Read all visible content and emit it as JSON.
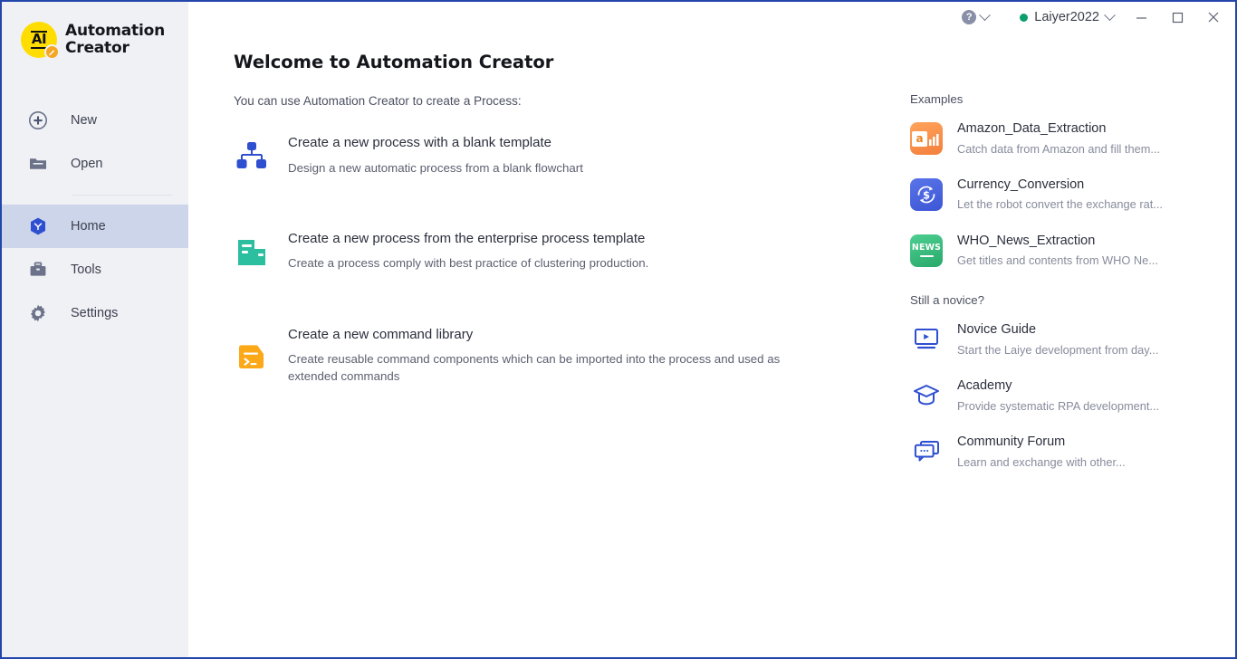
{
  "titlebar": {
    "help_icon": "help-circle-icon",
    "help_caret": "chevron-down-icon",
    "user_name": "Laiyer2022",
    "user_caret": "chevron-down-icon",
    "status_dot_color": "#0b9e6e",
    "minimize_label": "minimize",
    "maximize_label": "maximize",
    "close_label": "close"
  },
  "sidebar": {
    "brand_line1": "Automation",
    "brand_line2": "Creator",
    "brand_badge_icon": "pencil-icon",
    "brand_logo_text": "AI",
    "items": [
      {
        "label": "New",
        "icon": "plus-circle-icon",
        "active": false
      },
      {
        "label": "Open",
        "icon": "folder-icon",
        "active": false
      },
      {
        "label": "Home",
        "icon": "home-cube-icon",
        "active": true
      },
      {
        "label": "Tools",
        "icon": "toolbox-icon",
        "active": false
      },
      {
        "label": "Settings",
        "icon": "gear-icon",
        "active": false
      }
    ]
  },
  "main": {
    "title": "Welcome to Automation Creator",
    "subtitle": "You can use Automation Creator to create a Process:",
    "actions": [
      {
        "icon": "flowchart-icon",
        "title": "Create a new process with a blank template",
        "desc": "Design a new automatic process from a blank flowchart"
      },
      {
        "icon": "enterprise-template-icon",
        "title": "Create a new process from the enterprise process template",
        "desc": "Create a process comply with best practice of clustering production."
      },
      {
        "icon": "command-library-icon",
        "title": "Create a new command library",
        "desc": "Create reusable command components which can be imported into the process and used as extended commands"
      }
    ]
  },
  "right_panel": {
    "examples_title": "Examples",
    "examples": [
      {
        "icon": "amazon-icon",
        "name": "Amazon_Data_Extraction",
        "desc": "Catch data from Amazon and fill them..."
      },
      {
        "icon": "currency-icon",
        "name": "Currency_Conversion",
        "desc": "Let the robot convert the exchange rat..."
      },
      {
        "icon": "news-icon",
        "name": "WHO_News_Extraction",
        "desc": "Get titles and contents from WHO Ne..."
      }
    ],
    "novice_title": "Still a novice?",
    "novice": [
      {
        "icon": "video-player-icon",
        "name": "Novice Guide",
        "desc": "Start the Laiye development from day..."
      },
      {
        "icon": "graduation-cap-icon",
        "name": "Academy",
        "desc": "Provide systematic RPA development..."
      },
      {
        "icon": "chat-bubbles-icon",
        "name": "Community Forum",
        "desc": "Learn and exchange with other..."
      }
    ]
  },
  "colors": {
    "window_border": "#2346ab",
    "sidebar_bg": "#f0f1f5",
    "active_item_bg": "#ccd5e9",
    "brand_yellow": "#ffdd00",
    "accent_blue": "#2f4fd1",
    "teal": "#2bbfa0",
    "orange": "#fba919"
  }
}
